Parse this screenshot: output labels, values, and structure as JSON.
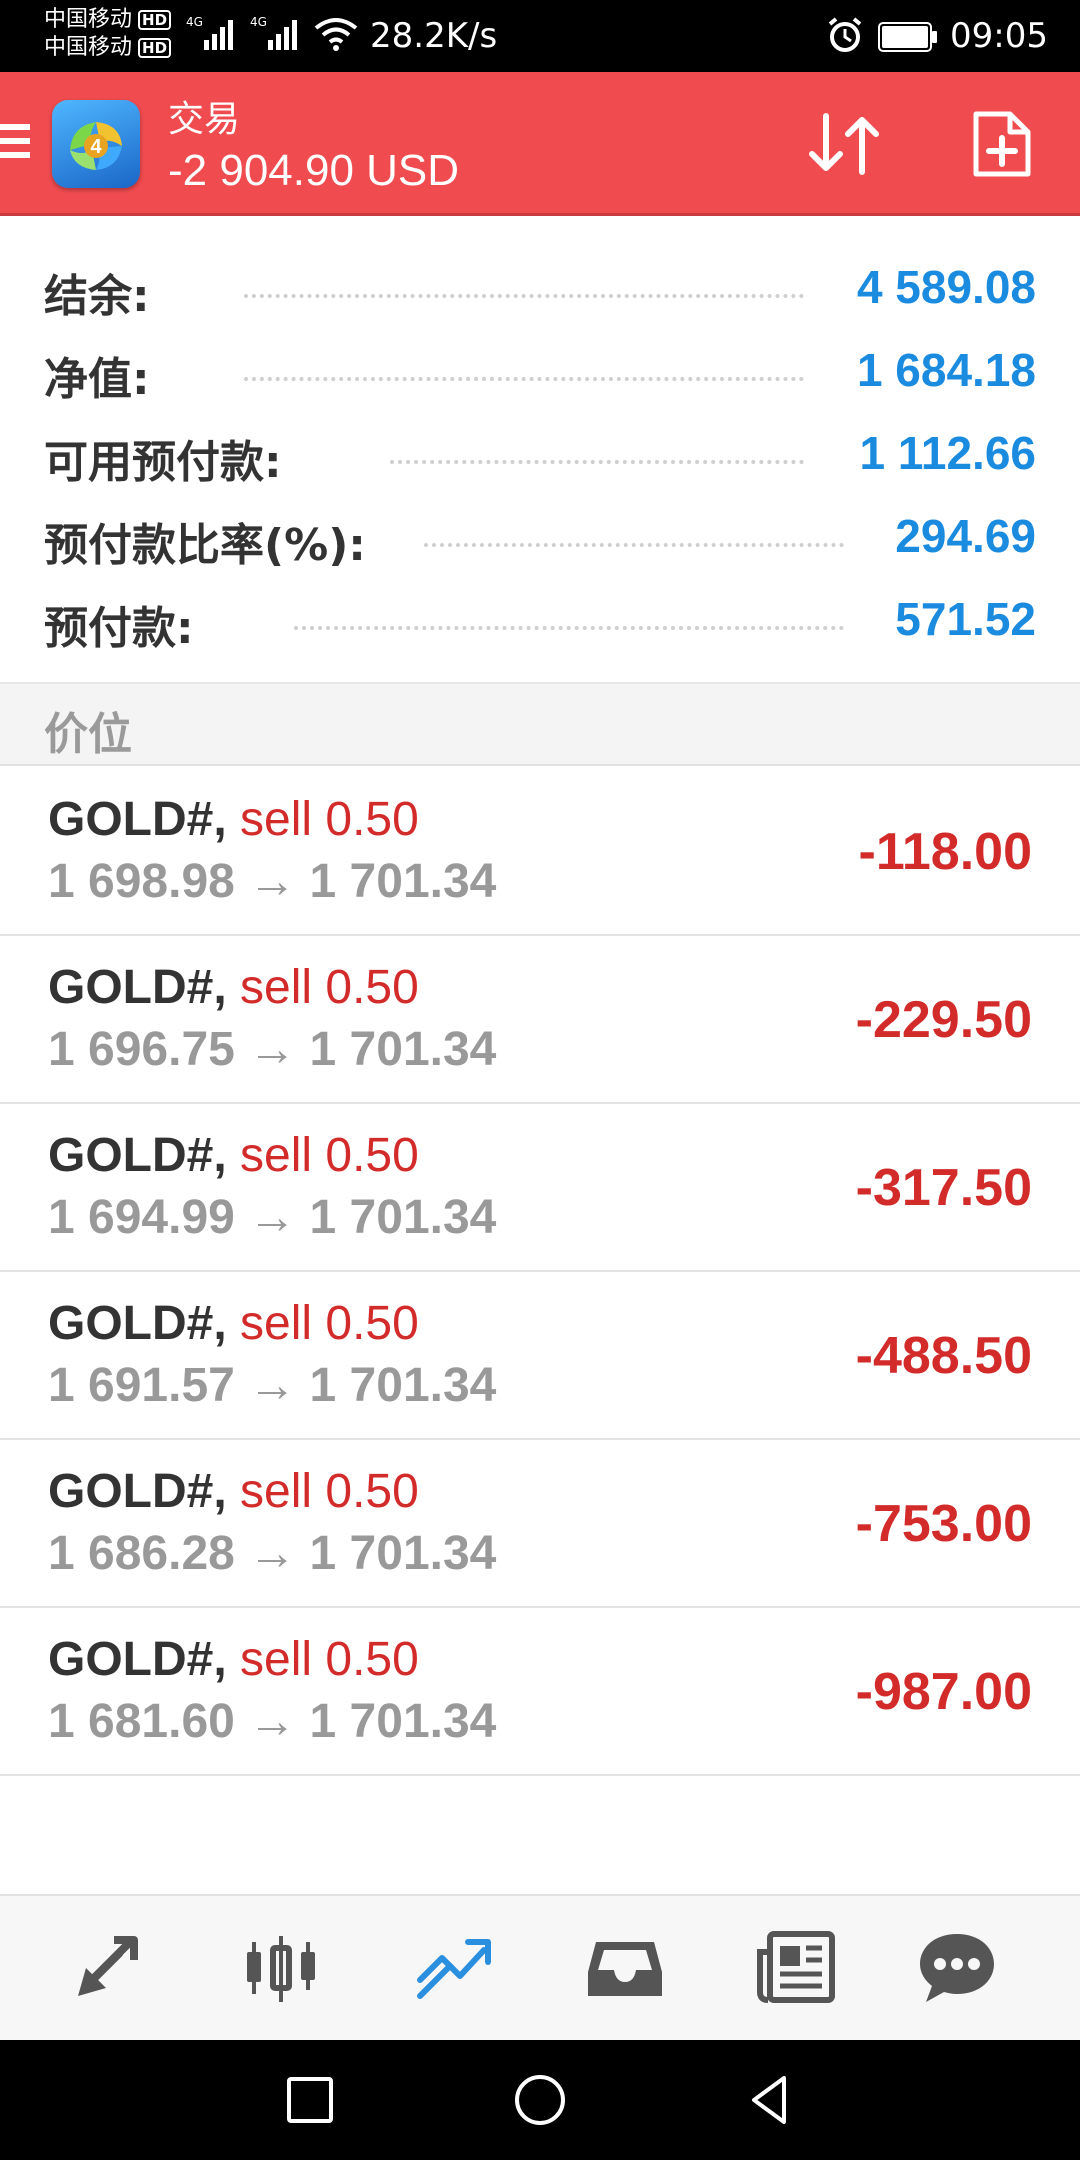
{
  "status_bar": {
    "carrier1": "中国移动",
    "carrier2": "中国移动",
    "hd_badge": "HD",
    "network1": "4G",
    "network2": "4G",
    "net_speed": "28.2K/s",
    "time": "09:05"
  },
  "app_bar": {
    "title": "交易",
    "balance_summary": "-2 904.90 USD",
    "logo_badge": "4"
  },
  "account": [
    {
      "label": "结余:",
      "value": "4 589.08"
    },
    {
      "label": "净值:",
      "value": "1 684.18"
    },
    {
      "label": "可用预付款:",
      "value": "1 112.66"
    },
    {
      "label": "预付款比率(%):",
      "value": "294.69"
    },
    {
      "label": "预付款:",
      "value": "571.52"
    }
  ],
  "section": {
    "title": "价位"
  },
  "positions": [
    {
      "symbol": "GOLD#,",
      "type": "sell 0.50",
      "prices": "1 698.98 → 1 701.34",
      "profit": "-118.00"
    },
    {
      "symbol": "GOLD#,",
      "type": "sell 0.50",
      "prices": "1 696.75 → 1 701.34",
      "profit": "-229.50"
    },
    {
      "symbol": "GOLD#,",
      "type": "sell 0.50",
      "prices": "1 694.99 → 1 701.34",
      "profit": "-317.50"
    },
    {
      "symbol": "GOLD#,",
      "type": "sell 0.50",
      "prices": "1 691.57 → 1 701.34",
      "profit": "-488.50"
    },
    {
      "symbol": "GOLD#,",
      "type": "sell 0.50",
      "prices": "1 686.28 → 1 701.34",
      "profit": "-753.00"
    },
    {
      "symbol": "GOLD#,",
      "type": "sell 0.50",
      "prices": "1 681.60 → 1 701.34",
      "profit": "-987.00"
    }
  ],
  "bottom_nav": [
    {
      "icon": "quotes-arrows-icon",
      "active": false
    },
    {
      "icon": "candlestick-chart-icon",
      "active": false
    },
    {
      "icon": "trade-trend-icon",
      "active": true
    },
    {
      "icon": "history-inbox-icon",
      "active": false
    },
    {
      "icon": "news-icon",
      "active": false
    },
    {
      "icon": "chat-icon",
      "active": false
    }
  ],
  "colors": {
    "app_bar": "#f04b4f",
    "value_blue": "#1b8be0",
    "loss_red": "#d32a2a",
    "active_nav": "#2b8fe0",
    "inactive_nav": "#555555"
  }
}
